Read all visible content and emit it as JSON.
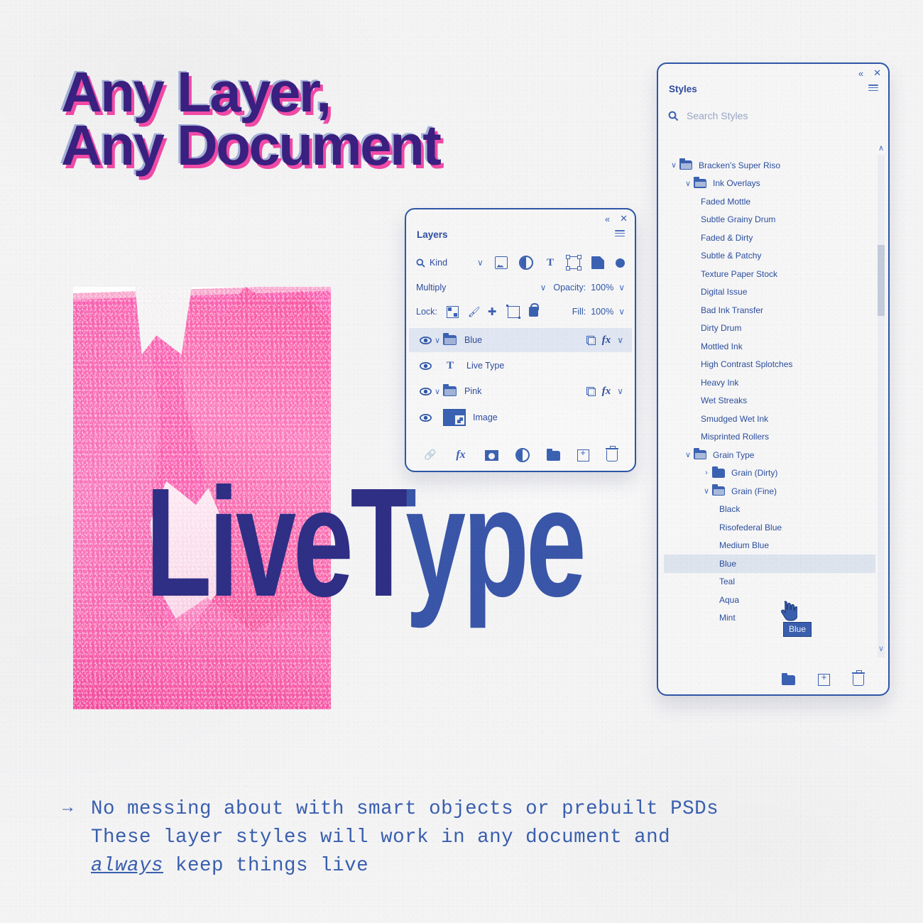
{
  "headline": {
    "line1": "Any Layer,",
    "line2": "Any Document",
    "color": "#3a2080",
    "shadow_color": "#f03ca0"
  },
  "artwork": {
    "live_type_text": "LiveType",
    "image_label": "pink duotone canyon cliffs photograph",
    "pink": "#fa5fb0",
    "blue": "#3a56a8"
  },
  "layers_panel": {
    "title": "Layers",
    "collapse_icon": "«",
    "close_icon": "✕",
    "menu_icon": "panel-menu-icon",
    "filter": {
      "label": "Kind",
      "chevron": "∨",
      "icons": [
        "pixel-layer-icon",
        "adjustment-layer-icon",
        "type-layer-icon",
        "shape-layer-icon",
        "smart-object-icon",
        "filter-toggle-dot"
      ]
    },
    "blend_mode": "Multiply",
    "opacity_label": "Opacity:",
    "opacity_value": "100%",
    "lock_label": "Lock:",
    "lock_icons": [
      "lock-transparent-pixels-icon",
      "lock-image-pixels-icon",
      "lock-position-icon",
      "lock-artboard-nesting-icon",
      "lock-all-icon"
    ],
    "fill_label": "Fill:",
    "fill_value": "100%",
    "rows": [
      {
        "name": "Blue",
        "type": "group",
        "selected": true,
        "visible": true,
        "has_mask": true,
        "has_fx": true,
        "expanded": true
      },
      {
        "name": "Live Type",
        "type": "text",
        "selected": false,
        "visible": true,
        "has_mask": false,
        "has_fx": false,
        "expanded": false
      },
      {
        "name": "Pink",
        "type": "group",
        "selected": false,
        "visible": true,
        "has_mask": true,
        "has_fx": true,
        "expanded": true
      },
      {
        "name": "Image",
        "type": "image",
        "selected": false,
        "visible": true,
        "has_mask": false,
        "has_fx": false,
        "expanded": false
      }
    ],
    "bottom_icons": [
      "link-layers-icon",
      "add-layer-style-icon",
      "add-layer-mask-icon",
      "new-adjustment-layer-icon",
      "new-group-icon",
      "new-layer-icon",
      "delete-layer-icon"
    ],
    "fx_label": "fx"
  },
  "styles_panel": {
    "title": "Styles",
    "collapse_icon": "«",
    "close_icon": "✕",
    "menu_icon": "panel-menu-icon",
    "search_placeholder": "Search Styles",
    "search_value": "",
    "search_icon": "search-icon",
    "scroll_up_icon": "∧",
    "scroll_down_icon": "∨",
    "tree": [
      {
        "label": "Bracken's Super Riso",
        "depth": 0,
        "kind": "folder",
        "expanded": true
      },
      {
        "label": "Ink Overlays",
        "depth": 1,
        "kind": "folder",
        "expanded": true
      },
      {
        "label": "Faded Mottle",
        "depth": 2,
        "kind": "style"
      },
      {
        "label": "Subtle Grainy Drum",
        "depth": 2,
        "kind": "style"
      },
      {
        "label": "Faded & Dirty",
        "depth": 2,
        "kind": "style"
      },
      {
        "label": "Subtle & Patchy",
        "depth": 2,
        "kind": "style"
      },
      {
        "label": "Texture Paper Stock",
        "depth": 2,
        "kind": "style"
      },
      {
        "label": "Digital Issue",
        "depth": 2,
        "kind": "style"
      },
      {
        "label": "Bad Ink Transfer",
        "depth": 2,
        "kind": "style"
      },
      {
        "label": "Dirty Drum",
        "depth": 2,
        "kind": "style"
      },
      {
        "label": "Mottled Ink",
        "depth": 2,
        "kind": "style"
      },
      {
        "label": "High Contrast Splotches",
        "depth": 2,
        "kind": "style"
      },
      {
        "label": "Heavy Ink",
        "depth": 2,
        "kind": "style"
      },
      {
        "label": "Wet Streaks",
        "depth": 2,
        "kind": "style"
      },
      {
        "label": "Smudged Wet Ink",
        "depth": 2,
        "kind": "style"
      },
      {
        "label": "Misprinted Rollers",
        "depth": 2,
        "kind": "style"
      },
      {
        "label": "Grain Type",
        "depth": 1,
        "kind": "folder",
        "expanded": true
      },
      {
        "label": "Grain (Dirty)",
        "depth": 2,
        "kind": "folder",
        "expanded": false
      },
      {
        "label": "Grain (Fine)",
        "depth": 2,
        "kind": "folder",
        "expanded": true
      },
      {
        "label": "Black",
        "depth": 3,
        "kind": "style"
      },
      {
        "label": "Risofederal Blue",
        "depth": 3,
        "kind": "style"
      },
      {
        "label": "Medium Blue",
        "depth": 3,
        "kind": "style"
      },
      {
        "label": "Blue",
        "depth": 3,
        "kind": "style",
        "selected": true
      },
      {
        "label": "Teal",
        "depth": 3,
        "kind": "style"
      },
      {
        "label": "Aqua",
        "depth": 3,
        "kind": "style"
      },
      {
        "label": "Mint",
        "depth": 3,
        "kind": "style"
      }
    ],
    "bottom_icons": [
      "new-style-group-icon",
      "new-style-icon",
      "delete-style-icon"
    ],
    "tooltip": "Blue",
    "cursor": "pointing-hand-cursor"
  },
  "caption": {
    "arrow": "→",
    "line1": "No messing about with smart objects or prebuilt PSDs",
    "line2": "These layer styles will work in any document and",
    "line3_emph": "always",
    "line3_rest": " keep things live",
    "color": "#3a5fae"
  }
}
